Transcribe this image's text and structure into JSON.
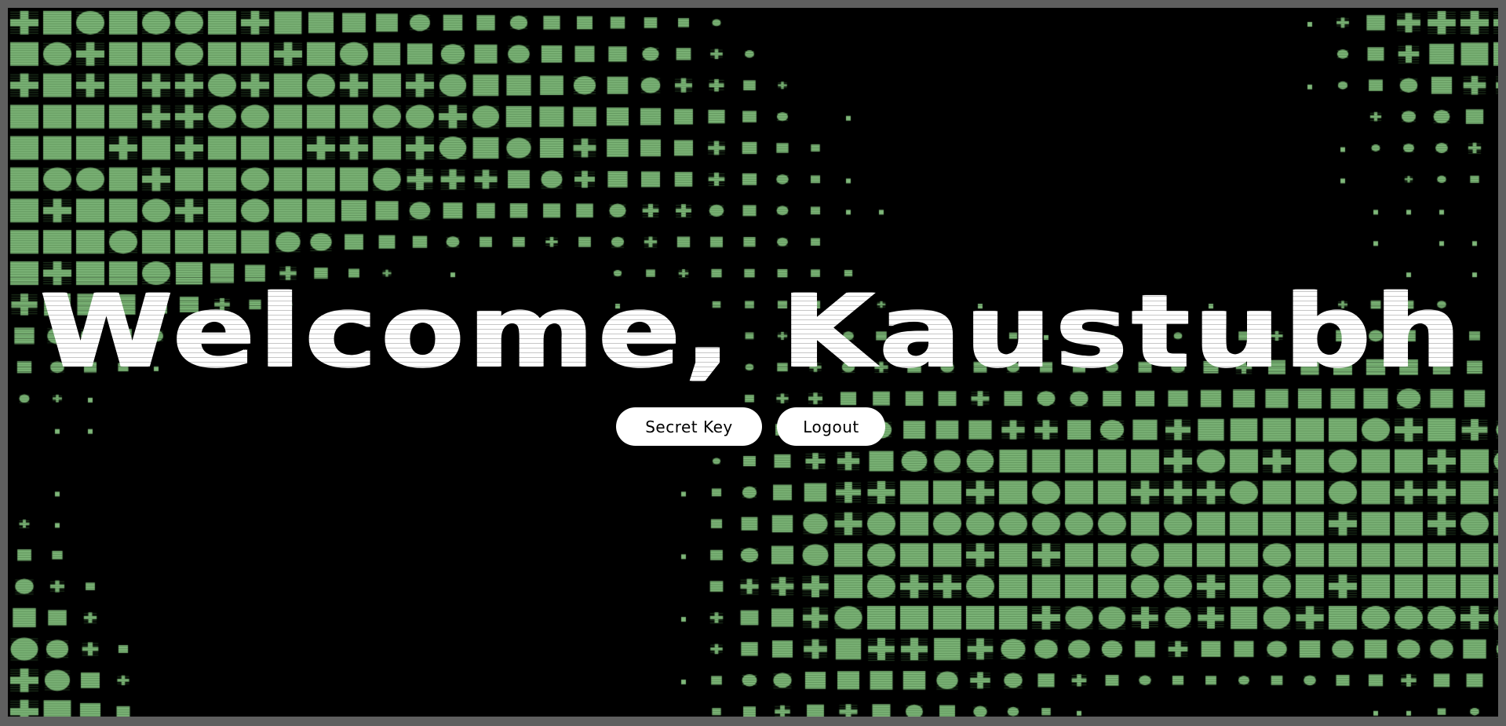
{
  "hero": {
    "greeting": "Welcome, Kaustubh"
  },
  "actions": {
    "secret_key_label": "Secret Key",
    "logout_label": "Logout"
  },
  "theme": {
    "background": "#000000",
    "tile_color": "#7fb87a",
    "tile_shade": "#3f6e3d",
    "frame": "#5f5f5f",
    "button_bg": "#ffffff",
    "text": "#ffffff"
  }
}
